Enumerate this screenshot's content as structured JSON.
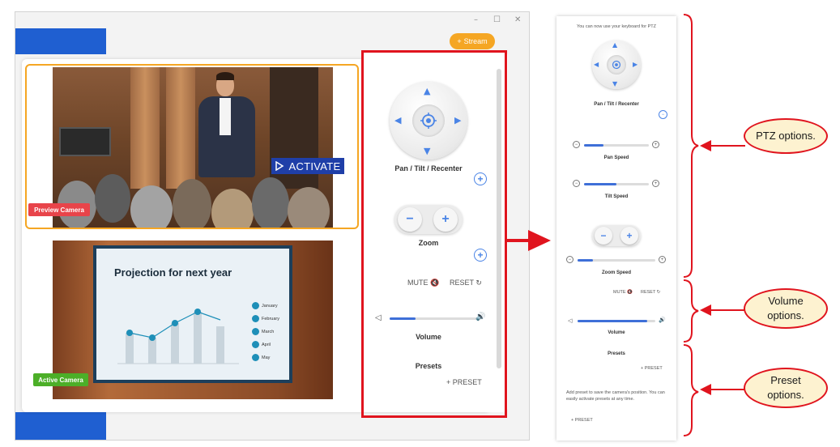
{
  "window": {
    "controls": {
      "minimize": "–",
      "maximize": "☐",
      "close": "✕"
    },
    "stream_button": "Stream"
  },
  "cameras": {
    "preview": {
      "label": "Preview Camera",
      "activate_button": "ACTIVATE"
    },
    "active": {
      "label": "Active Camera",
      "slide_title": "Projection for next year",
      "slide_legend": [
        "January",
        "February",
        "March",
        "April",
        "May"
      ]
    }
  },
  "ptz_panel": {
    "pan_tilt_label": "Pan / Tilt / Recenter",
    "zoom_label": "Zoom",
    "mute_label": "MUTE",
    "reset_label": "RESET",
    "volume_label": "Volume",
    "volume_level": 0.3,
    "presets_label": "Presets",
    "add_preset": "+ PRESET"
  },
  "right_panel": {
    "keyboard_hint": "You can now use your keyboard for PTZ",
    "pan_tilt_label": "Pan / Tilt / Recenter",
    "pan_speed_label": "Pan Speed",
    "pan_speed_level": 0.3,
    "tilt_speed_label": "Tilt Speed",
    "tilt_speed_level": 0.5,
    "zoom_speed_label": "Zoom Speed",
    "zoom_speed_level": 0.2,
    "mute_label": "MUTE",
    "reset_label": "RESET",
    "volume_label": "Volume",
    "volume_level": 0.9,
    "presets_label": "Presets",
    "add_preset": "+ PRESET",
    "preset_hint": "Add preset to save the camera's position. You can easily activate presets at any time.",
    "add_preset_bottom": "+ PRESET"
  },
  "callouts": {
    "ptz": "PTZ options.",
    "volume": "Volume options.",
    "preset": "Preset options."
  },
  "colors": {
    "accent": "#1f5fd1",
    "highlight": "#e0141e",
    "callout_fill": "#fdf2d0",
    "stream": "#f5a623"
  }
}
